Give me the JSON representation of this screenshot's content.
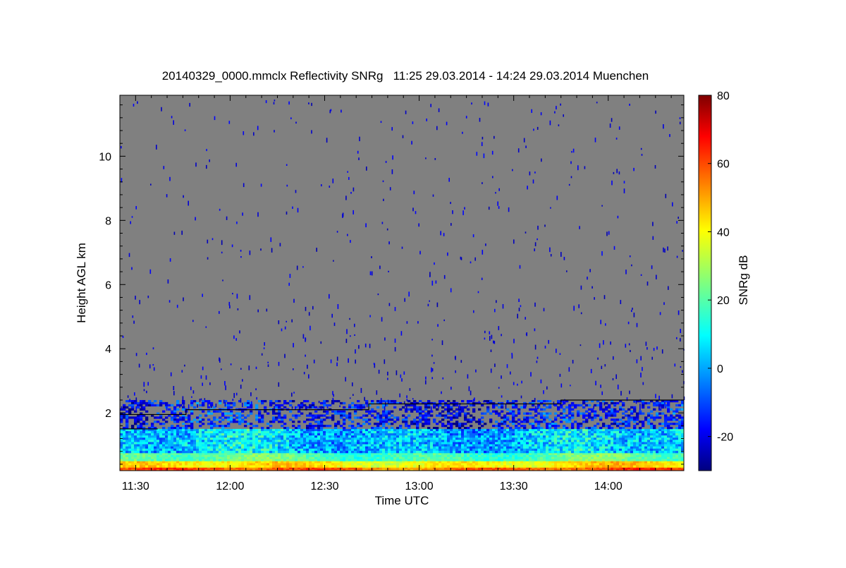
{
  "chart_data": {
    "type": "heatmap",
    "title": "20140329_0000.mmclx Reflectivity SNRg   11:25 29.03.2014 - 14:24 29.03.2014 Muenchen",
    "xlabel": "Time UTC",
    "ylabel": "Height AGL km",
    "x_ticks": [
      "11:30",
      "12:00",
      "12:30",
      "13:00",
      "13:30",
      "14:00"
    ],
    "x_range": [
      "11:25",
      "14:24"
    ],
    "y_ticks": [
      "2",
      "4",
      "6",
      "8",
      "10"
    ],
    "y_range": [
      0.2,
      11.9
    ],
    "colorbar": {
      "label": "SNRg dB",
      "ticks": [
        "-20",
        "0",
        "20",
        "40",
        "60",
        "80"
      ],
      "range": [
        -30,
        80
      ],
      "colormap": "jet"
    },
    "background_color": "#808080",
    "line_color": "#000000",
    "boundary_line": {
      "name": "",
      "segments": [
        {
          "start": "11:25",
          "end": "11:46",
          "height_km": 1.95
        },
        {
          "start": "11:46",
          "end": "12:44",
          "height_km": 2.1
        },
        {
          "start": "12:44",
          "end": "13:45",
          "height_km": 2.28
        },
        {
          "start": "13:45",
          "end": "14:24",
          "height_km": 2.4
        }
      ]
    },
    "lower_line": {
      "segments": [
        {
          "start": "11:25",
          "end": "11:37",
          "height_km": 1.5
        }
      ]
    },
    "echo_layers": [
      {
        "name": "",
        "bottom_km": 0.2,
        "top_km": 0.3,
        "snr_db": 55
      },
      {
        "name": "",
        "bottom_km": 0.3,
        "top_km": 0.5,
        "snr_db": 40
      },
      {
        "name": "",
        "bottom_km": 0.5,
        "top_km": 0.75,
        "snr_db": 20
      },
      {
        "name": "",
        "bottom_km": 0.75,
        "top_km": 1.5,
        "snr_db": 5
      },
      {
        "name": "",
        "bottom_km": 1.5,
        "top_km": 2.4,
        "snr_db": -15
      }
    ]
  }
}
